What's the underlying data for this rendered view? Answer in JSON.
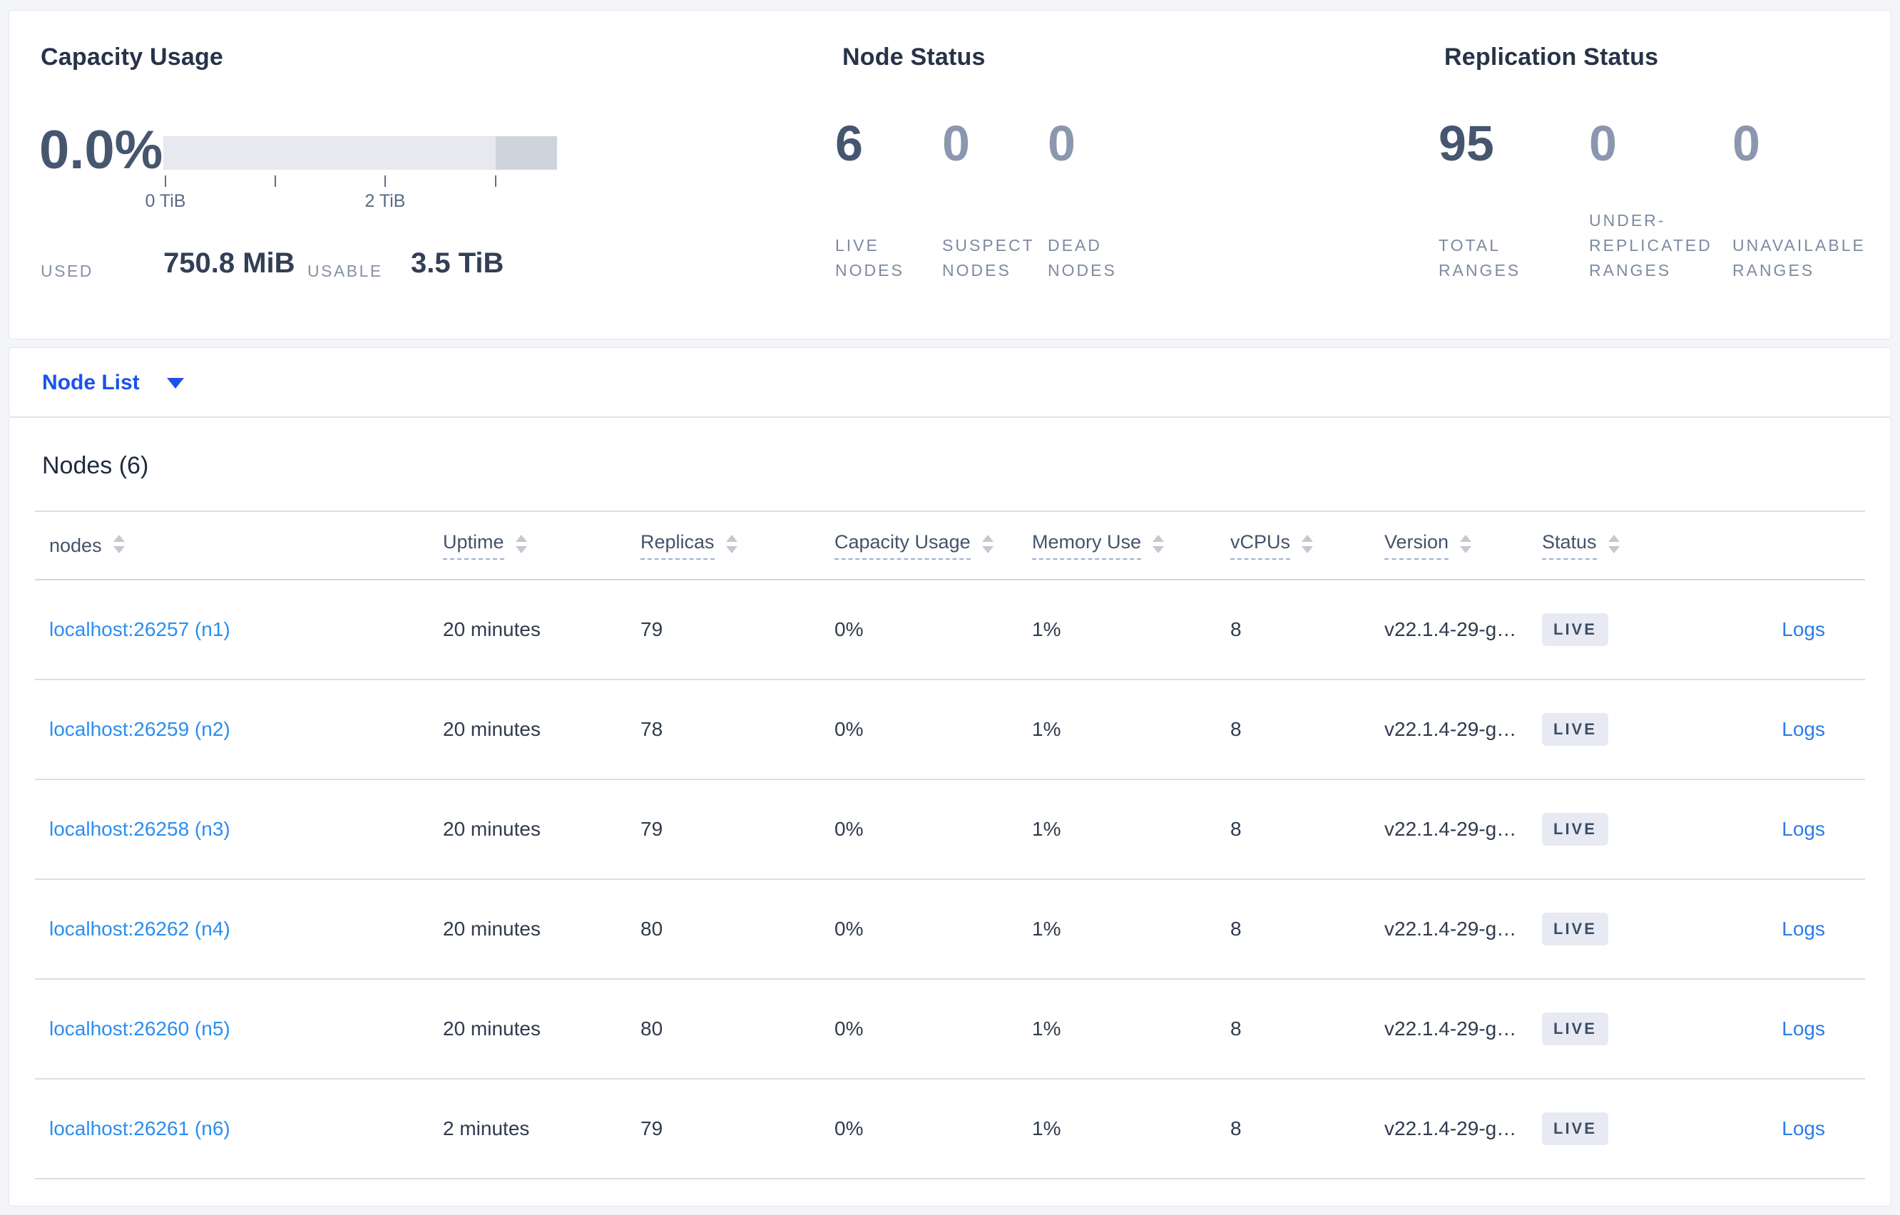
{
  "capacity_panel": {
    "title": "Capacity Usage",
    "percent_used": "0.0%",
    "gauge": {
      "tick_labels": [
        "0 TiB",
        "2 TiB"
      ],
      "bar_color": "#e7e9ef",
      "bar_end_color": "#ced3dc"
    },
    "used_label": "USED",
    "used_value": "750.8 MiB",
    "usable_label": "USABLE",
    "usable_value": "3.5 TiB"
  },
  "node_status_panel": {
    "title": "Node Status",
    "stats": [
      {
        "value": "6",
        "label": "LIVE NODES"
      },
      {
        "value": "0",
        "label": "SUSPECT NODES"
      },
      {
        "value": "0",
        "label": "DEAD NODES"
      }
    ]
  },
  "replication_panel": {
    "title": "Replication Status",
    "stats": [
      {
        "value": "95",
        "label": "TOTAL RANGES"
      },
      {
        "value": "0",
        "label": "UNDER-REPLICATED RANGES"
      },
      {
        "value": "0",
        "label": "UNAVAILABLE RANGES"
      }
    ]
  },
  "node_list_dropdown": {
    "label": "Node List"
  },
  "nodes_table": {
    "title": "Nodes (6)",
    "columns": [
      "nodes",
      "Uptime",
      "Replicas",
      "Capacity Usage",
      "Memory Use",
      "vCPUs",
      "Version",
      "Status"
    ],
    "logs_label": "Logs",
    "rows": [
      {
        "node": "localhost:26257 (n1)",
        "uptime": "20 minutes",
        "replicas": "79",
        "capacity": "0%",
        "memory": "1%",
        "vcpus": "8",
        "version": "v22.1.4-29-g…",
        "status": "LIVE"
      },
      {
        "node": "localhost:26259 (n2)",
        "uptime": "20 minutes",
        "replicas": "78",
        "capacity": "0%",
        "memory": "1%",
        "vcpus": "8",
        "version": "v22.1.4-29-g…",
        "status": "LIVE"
      },
      {
        "node": "localhost:26258 (n3)",
        "uptime": "20 minutes",
        "replicas": "79",
        "capacity": "0%",
        "memory": "1%",
        "vcpus": "8",
        "version": "v22.1.4-29-g…",
        "status": "LIVE"
      },
      {
        "node": "localhost:26262 (n4)",
        "uptime": "20 minutes",
        "replicas": "80",
        "capacity": "0%",
        "memory": "1%",
        "vcpus": "8",
        "version": "v22.1.4-29-g…",
        "status": "LIVE"
      },
      {
        "node": "localhost:26260 (n5)",
        "uptime": "20 minutes",
        "replicas": "80",
        "capacity": "0%",
        "memory": "1%",
        "vcpus": "8",
        "version": "v22.1.4-29-g…",
        "status": "LIVE"
      },
      {
        "node": "localhost:26261 (n6)",
        "uptime": "2 minutes",
        "replicas": "79",
        "capacity": "0%",
        "memory": "1%",
        "vcpus": "8",
        "version": "v22.1.4-29-g…",
        "status": "LIVE"
      }
    ]
  },
  "colors": {
    "page_background": "#f4f5f9",
    "accent_blue": "#1b52e8",
    "link_blue": "#2b8ef0",
    "stat_dark": "#46566f",
    "stat_muted": "#8b97ae",
    "badge_background": "#e7eaf2"
  }
}
